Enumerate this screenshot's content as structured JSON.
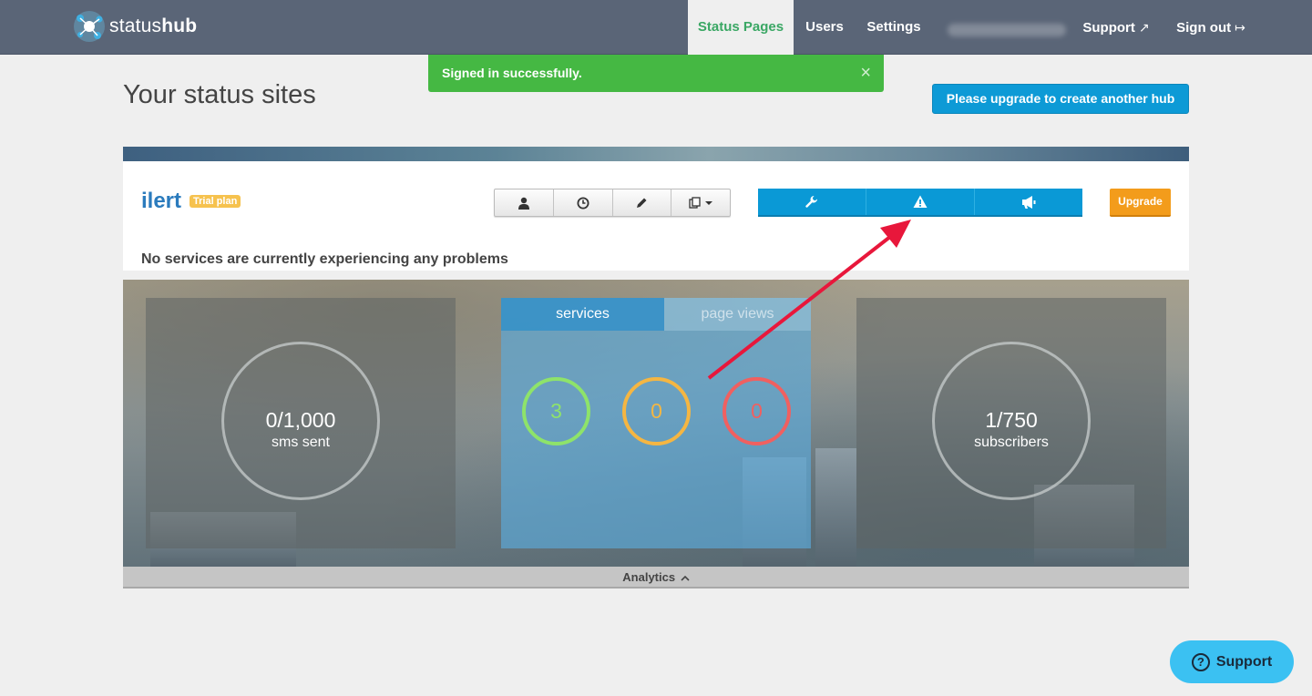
{
  "navbar": {
    "logo_text_light": "status",
    "logo_text_bold": "hub",
    "items": [
      {
        "label": "Status Pages",
        "active": true
      },
      {
        "label": "Users"
      },
      {
        "label": "Settings"
      },
      {
        "label": "Support"
      },
      {
        "label": "Sign out"
      }
    ]
  },
  "alert": {
    "message": "Signed in successfully.",
    "close": "×"
  },
  "page": {
    "title": "Your status sites",
    "upgrade_hub_label": "Please upgrade to create another hub"
  },
  "hub": {
    "name": "ilert",
    "plan_badge": "Trial plan",
    "upgrade_label": "Upgrade",
    "status_message": "No services are currently experiencing any problems",
    "toolbar_icons": [
      "user-icon",
      "clock-icon",
      "pencil-icon",
      "copy-dropdown-icon"
    ],
    "action_icons": [
      "wrench-icon",
      "warning-icon",
      "megaphone-icon"
    ]
  },
  "analytics": {
    "sms": {
      "value": "0/1,000",
      "label": "sms sent"
    },
    "tabs": [
      {
        "label": "services",
        "active": true
      },
      {
        "label": "page views"
      }
    ],
    "services": [
      {
        "count": "3",
        "color": "#8ee36a"
      },
      {
        "count": "0",
        "color": "#f5b642"
      },
      {
        "count": "0",
        "color": "#f06060"
      }
    ],
    "subscribers": {
      "value": "1/750",
      "label": "subscribers"
    },
    "toggle_label": "Analytics"
  },
  "support_widget": {
    "label": "Support"
  },
  "colors": {
    "nav": "#5a6577",
    "success": "#45b843",
    "primary": "#0a99d6",
    "warning": "#f39c1b",
    "arrow": "#e8173b"
  }
}
